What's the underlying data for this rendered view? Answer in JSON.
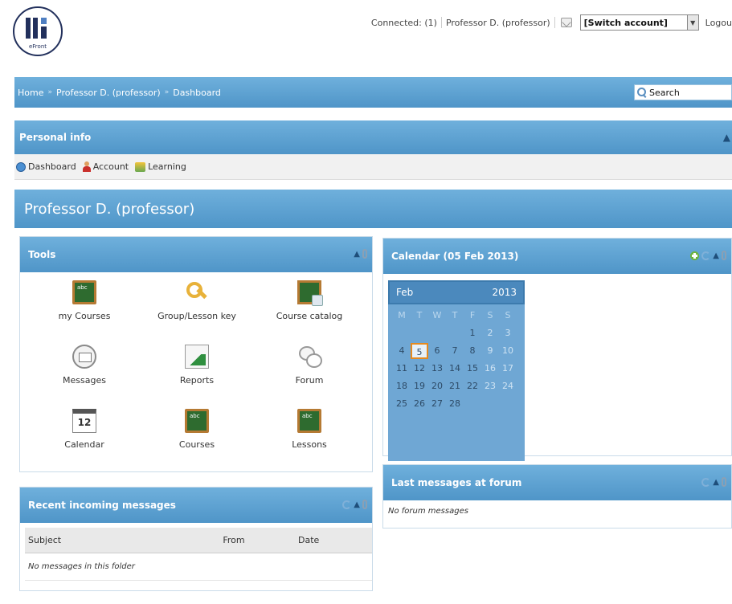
{
  "header": {
    "logo_text": "eFront",
    "connected": "Connected: (1)",
    "user": "Professor D. (professor)",
    "switch_account": "[Switch account]",
    "logout": "Logou"
  },
  "breadcrumb": {
    "items": [
      "Home",
      "Professor D. (professor)",
      "Dashboard"
    ],
    "search_label": "Search"
  },
  "personal_info": {
    "title": "Personal info",
    "tabs": [
      {
        "label": "Dashboard",
        "icon": "dashboard-icon"
      },
      {
        "label": "Account",
        "icon": "user-icon"
      },
      {
        "label": "Learning",
        "icon": "learning-icon"
      }
    ]
  },
  "profile_name": "Professor D. (professor)",
  "tools": {
    "title": "Tools",
    "items": [
      {
        "label": "my Courses",
        "icon": "chalkboard-icon"
      },
      {
        "label": "Group/Lesson key",
        "icon": "key-icon"
      },
      {
        "label": "Course catalog",
        "icon": "catalog-icon"
      },
      {
        "label": "Messages",
        "icon": "envelope-icon"
      },
      {
        "label": "Reports",
        "icon": "report-chart-icon"
      },
      {
        "label": "Forum",
        "icon": "speech-bubbles-icon"
      },
      {
        "label": "Calendar",
        "icon": "calendar-icon",
        "glyph": "12"
      },
      {
        "label": "Courses",
        "icon": "chalkboard-icon"
      },
      {
        "label": "Lessons",
        "icon": "chalkboard-icon"
      }
    ]
  },
  "calendar": {
    "title": "Calendar (05 Feb 2013)",
    "month": "Feb",
    "year": "2013",
    "dow": [
      "M",
      "T",
      "W",
      "T",
      "F",
      "S",
      "S"
    ],
    "weeks": [
      [
        "",
        "",
        "",
        "",
        "1",
        "2",
        "3"
      ],
      [
        "4",
        "5",
        "6",
        "7",
        "8",
        "9",
        "10"
      ],
      [
        "11",
        "12",
        "13",
        "14",
        "15",
        "16",
        "17"
      ],
      [
        "18",
        "19",
        "20",
        "21",
        "22",
        "23",
        "24"
      ],
      [
        "25",
        "26",
        "27",
        "28",
        "",
        "",
        ""
      ]
    ],
    "today": "5"
  },
  "recent_messages": {
    "title": "Recent incoming messages",
    "columns": [
      "Subject",
      "From",
      "Date"
    ],
    "empty": "No messages in this folder"
  },
  "forum": {
    "title": "Last messages at forum",
    "empty": "No forum messages"
  },
  "colors": {
    "header_blue": "#5aa0d2",
    "today_outline": "#e58a1f"
  }
}
